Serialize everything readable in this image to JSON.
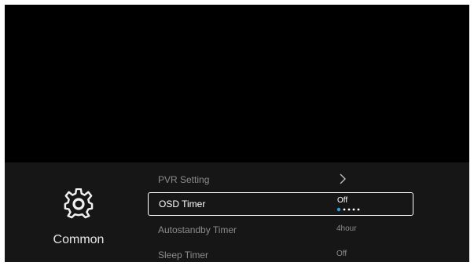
{
  "menu": {
    "category_label": "Common",
    "items": [
      {
        "label": "PVR Setting",
        "value": "",
        "has_submenu": true
      },
      {
        "label": "OSD Timer",
        "value": "Off",
        "selected": true,
        "options_count": 5,
        "option_index": 0
      },
      {
        "label": "Autostandby Timer",
        "value": "4hour"
      },
      {
        "label": "Sleep Timer",
        "value": "Off"
      }
    ]
  },
  "colors": {
    "panel_bg": "#161616",
    "accent": "#29a3e0",
    "dot_inactive": "#ffffff"
  },
  "icons": {
    "category": "gear-icon",
    "submenu": "chevron-right-icon"
  }
}
